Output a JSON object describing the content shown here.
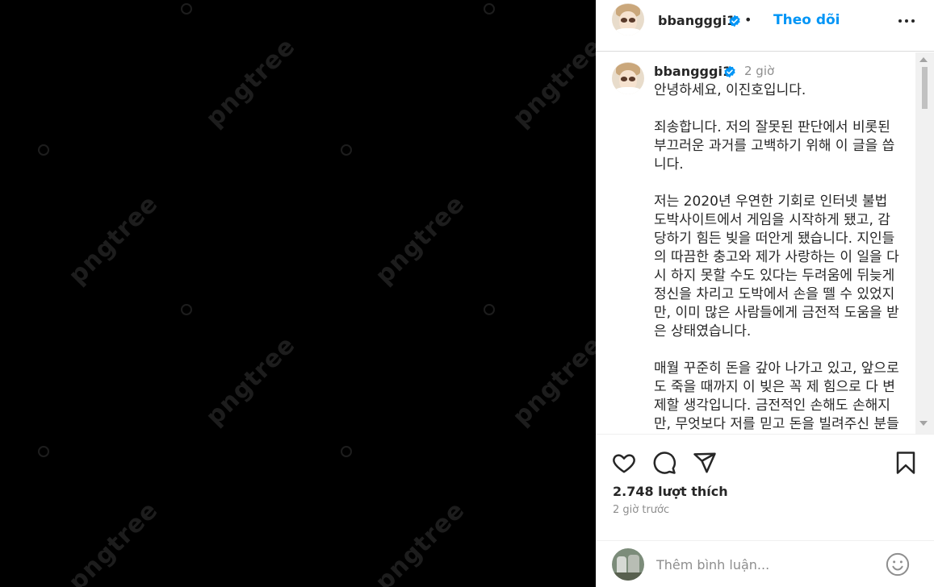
{
  "post": {
    "username": "bbangggi1",
    "follow_label": "Theo dõi",
    "separator": "•"
  },
  "caption": {
    "username": "bbangggi1",
    "time": "2 giờ",
    "text": "안녕하세요, 이진호입니다.\n\n죄송합니다. 저의 잘못된 판단에서 비롯된 부끄러운 과거를 고백하기 위해 이 글을 씁니다.\n\n저는 2020년 우연한 기회로 인터넷 불법 도박사이트에서 게임을 시작하게 됐고, 감당하기 힘든 빚을 떠안게 됐습니다. 지인들의 따끔한 충고와 제가 사랑하는 이 일을 다시 하지 못할 수도 있다는 두려움에 뒤늦게 정신을 차리고 도박에서 손을 뗄 수 있었지만, 이미 많은 사람들에게 금전적 도움을 받은 상태였습니다.\n\n매월 꾸준히 돈을 갚아 나가고 있고, 앞으로도 죽을 때까지 이 빚은 꼭 제 힘으로 다 변제할 생각입니다. 금전적인 손해도 손해지만, 무엇보다 저를 믿고 돈을 빌려주신 분들께 너무 죄송합니다. 모"
  },
  "stats": {
    "likes": "2.748 lượt thích",
    "ago": "2 giờ trước"
  },
  "comment": {
    "placeholder": "Thêm bình luận..."
  },
  "watermark": {
    "text": "pngtree"
  },
  "colors": {
    "accent": "#0095f6",
    "verified": "#0095f6",
    "text": "#262626",
    "secondary": "#8e8e8e"
  },
  "icons": [
    "more-icon",
    "verified-icon",
    "heart-icon",
    "comment-icon",
    "share-icon",
    "bookmark-icon",
    "emoji-icon"
  ]
}
